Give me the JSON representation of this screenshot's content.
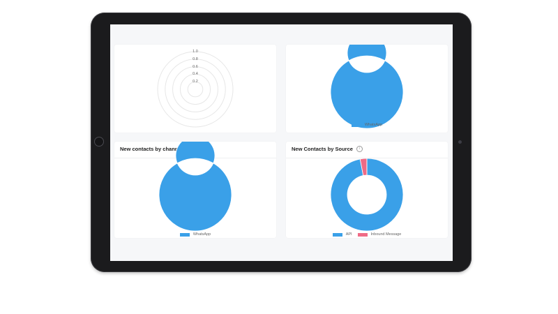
{
  "colors": {
    "whatsapp": "#3aa0e8",
    "api": "#3aa0e8",
    "inbound_message": "#ef6b86",
    "grid": "#e6e6e6"
  },
  "cards": {
    "radar": {
      "ticks": [
        "1.0",
        "0.8",
        "0.6",
        "0.4",
        "0.2"
      ]
    },
    "donut_top": {
      "legend": [
        {
          "label": "WhatsApp",
          "color": "#3aa0e8"
        }
      ]
    },
    "contacts_by_channel": {
      "title": "New contacts by channel",
      "legend": [
        {
          "label": "WhatsApp",
          "color": "#3aa0e8"
        }
      ]
    },
    "contacts_by_source": {
      "title": "New Contacts by Source",
      "info_icon": "info-icon",
      "legend": [
        {
          "label": "API",
          "color": "#3aa0e8"
        },
        {
          "label": "Inbound Message",
          "color": "#ef6b86"
        }
      ]
    }
  },
  "chart_data": [
    {
      "type": "radar",
      "title": "",
      "rlim": [
        0,
        1.0
      ],
      "ticks": [
        0.2,
        0.4,
        0.6,
        0.8,
        1.0
      ],
      "series": []
    },
    {
      "type": "pie",
      "title": "",
      "categories": [
        "WhatsApp"
      ],
      "values": [
        100
      ]
    },
    {
      "type": "pie",
      "title": "New contacts by channel",
      "categories": [
        "WhatsApp"
      ],
      "values": [
        100
      ]
    },
    {
      "type": "pie",
      "title": "New Contacts by Source",
      "categories": [
        "API",
        "Inbound Message"
      ],
      "values": [
        97,
        3
      ]
    }
  ]
}
